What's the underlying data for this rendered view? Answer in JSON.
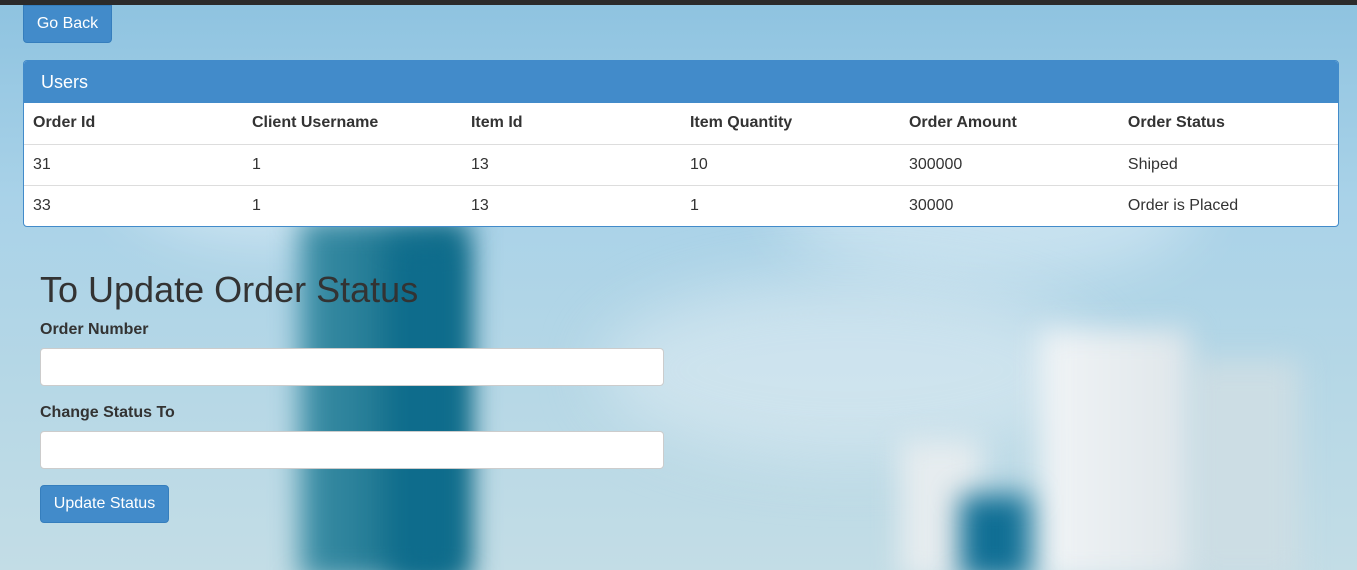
{
  "nav": {
    "back_label": "Go Back"
  },
  "panel": {
    "title": "Users",
    "columns": [
      "Order Id",
      "Client Username",
      "Item Id",
      "Item Quantity",
      "Order Amount",
      "Order Status"
    ],
    "rows": [
      [
        "31",
        "1",
        "13",
        "10",
        "300000",
        "Shiped"
      ],
      [
        "33",
        "1",
        "13",
        "1",
        "30000",
        "Order is Placed"
      ]
    ]
  },
  "form": {
    "title": "To Update Order Status",
    "order_number_label": "Order Number",
    "order_number_value": "",
    "status_label": "Change Status To",
    "status_value": "",
    "submit_label": "Update Status"
  },
  "colors": {
    "primary": "#428bca",
    "primary_border": "#357ebd",
    "text": "#333333"
  }
}
